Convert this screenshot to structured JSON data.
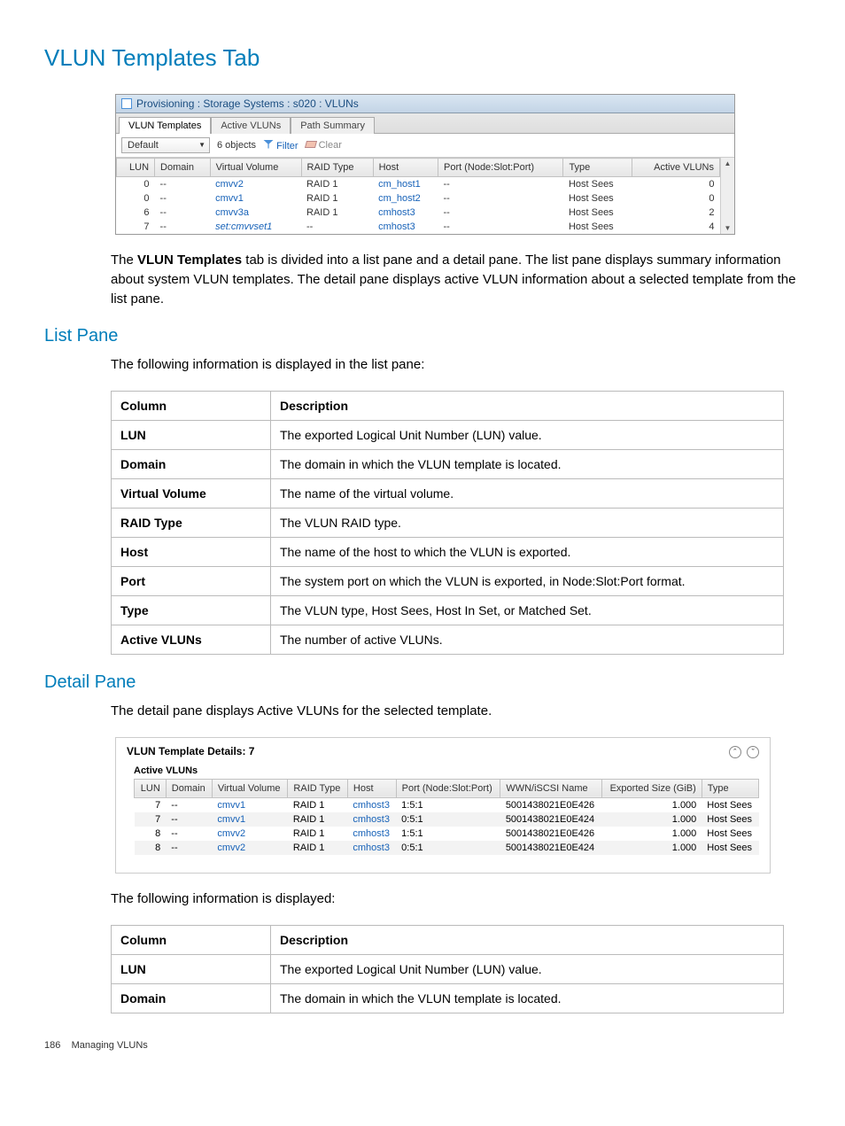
{
  "page_title": "VLUN Templates Tab",
  "sections": {
    "intro_pre": "The ",
    "intro_bold": "VLUN Templates",
    "intro_post": " tab is divided into a list pane and a detail pane. The list pane displays summary information about system VLUN templates. The detail pane displays active VLUN information about a selected template from the list pane.",
    "list_pane_heading": "List Pane",
    "list_pane_text": "The following information is displayed in the list pane:",
    "detail_pane_heading": "Detail Pane",
    "detail_pane_text": "The detail pane displays Active VLUNs for the selected template.",
    "detail_following_text": "The following information is displayed:"
  },
  "screenshot1": {
    "titlebar": "Provisioning : Storage Systems : s020 : VLUNs",
    "tabs": [
      "VLUN Templates",
      "Active VLUNs",
      "Path Summary"
    ],
    "active_tab": "VLUN Templates",
    "dropdown_value": "Default",
    "object_count": "6 objects",
    "filter_label": "Filter",
    "clear_label": "Clear",
    "columns": [
      "LUN",
      "Domain",
      "Virtual Volume",
      "RAID Type",
      "Host",
      "Port (Node:Slot:Port)",
      "Type",
      "Active VLUNs"
    ],
    "rows": [
      {
        "lun": "0",
        "domain": "--",
        "vv": "cmvv2",
        "raid": "RAID 1",
        "host": "cm_host1",
        "port": "--",
        "type": "Host Sees",
        "active": "0"
      },
      {
        "lun": "0",
        "domain": "--",
        "vv": "cmvv1",
        "raid": "RAID 1",
        "host": "cm_host2",
        "port": "--",
        "type": "Host Sees",
        "active": "0"
      },
      {
        "lun": "6",
        "domain": "--",
        "vv": "cmvv3a",
        "raid": "RAID 1",
        "host": "cmhost3",
        "port": "--",
        "type": "Host Sees",
        "active": "2"
      },
      {
        "lun": "7",
        "domain": "--",
        "vv": "set:cmvvset1",
        "vv_style": "italic",
        "raid": "--",
        "host": "cmhost3",
        "port": "--",
        "type": "Host Sees",
        "active": "4"
      }
    ]
  },
  "list_pane_table": {
    "headers": [
      "Column",
      "Description"
    ],
    "rows": [
      [
        "LUN",
        "The exported Logical Unit Number (LUN) value."
      ],
      [
        "Domain",
        "The domain in which the VLUN template is located."
      ],
      [
        "Virtual Volume",
        "The name of the virtual volume."
      ],
      [
        "RAID Type",
        "The VLUN RAID type."
      ],
      [
        "Host",
        "The name of the host to which the VLUN is exported."
      ],
      [
        "Port",
        "The system port on which the VLUN is exported, in Node:Slot:Port format."
      ],
      [
        "Type",
        "The VLUN type, Host Sees, Host In Set, or Matched Set."
      ],
      [
        "Active VLUNs",
        "The number of active VLUNs."
      ]
    ]
  },
  "screenshot2": {
    "header": "VLUN Template Details: 7",
    "subheader": "Active VLUNs",
    "columns": [
      "LUN",
      "Domain",
      "Virtual Volume",
      "RAID Type",
      "Host",
      "Port (Node:Slot:Port)",
      "WWN/iSCSI Name",
      "Exported Size (GiB)",
      "Type"
    ],
    "rows": [
      {
        "lun": "7",
        "domain": "--",
        "vv": "cmvv1",
        "raid": "RAID 1",
        "host": "cmhost3",
        "port": "1:5:1",
        "wwn": "5001438021E0E426",
        "size": "1.000",
        "type": "Host Sees"
      },
      {
        "lun": "7",
        "domain": "--",
        "vv": "cmvv1",
        "raid": "RAID 1",
        "host": "cmhost3",
        "port": "0:5:1",
        "wwn": "5001438021E0E424",
        "size": "1.000",
        "type": "Host Sees"
      },
      {
        "lun": "8",
        "domain": "--",
        "vv": "cmvv2",
        "raid": "RAID 1",
        "host": "cmhost3",
        "port": "1:5:1",
        "wwn": "5001438021E0E426",
        "size": "1.000",
        "type": "Host Sees"
      },
      {
        "lun": "8",
        "domain": "--",
        "vv": "cmvv2",
        "raid": "RAID 1",
        "host": "cmhost3",
        "port": "0:5:1",
        "wwn": "5001438021E0E424",
        "size": "1.000",
        "type": "Host Sees"
      }
    ]
  },
  "detail_table": {
    "headers": [
      "Column",
      "Description"
    ],
    "rows": [
      [
        "LUN",
        "The exported Logical Unit Number (LUN) value."
      ],
      [
        "Domain",
        "The domain in which the VLUN template is located."
      ]
    ]
  },
  "footer": {
    "page_number": "186",
    "section": "Managing VLUNs"
  }
}
